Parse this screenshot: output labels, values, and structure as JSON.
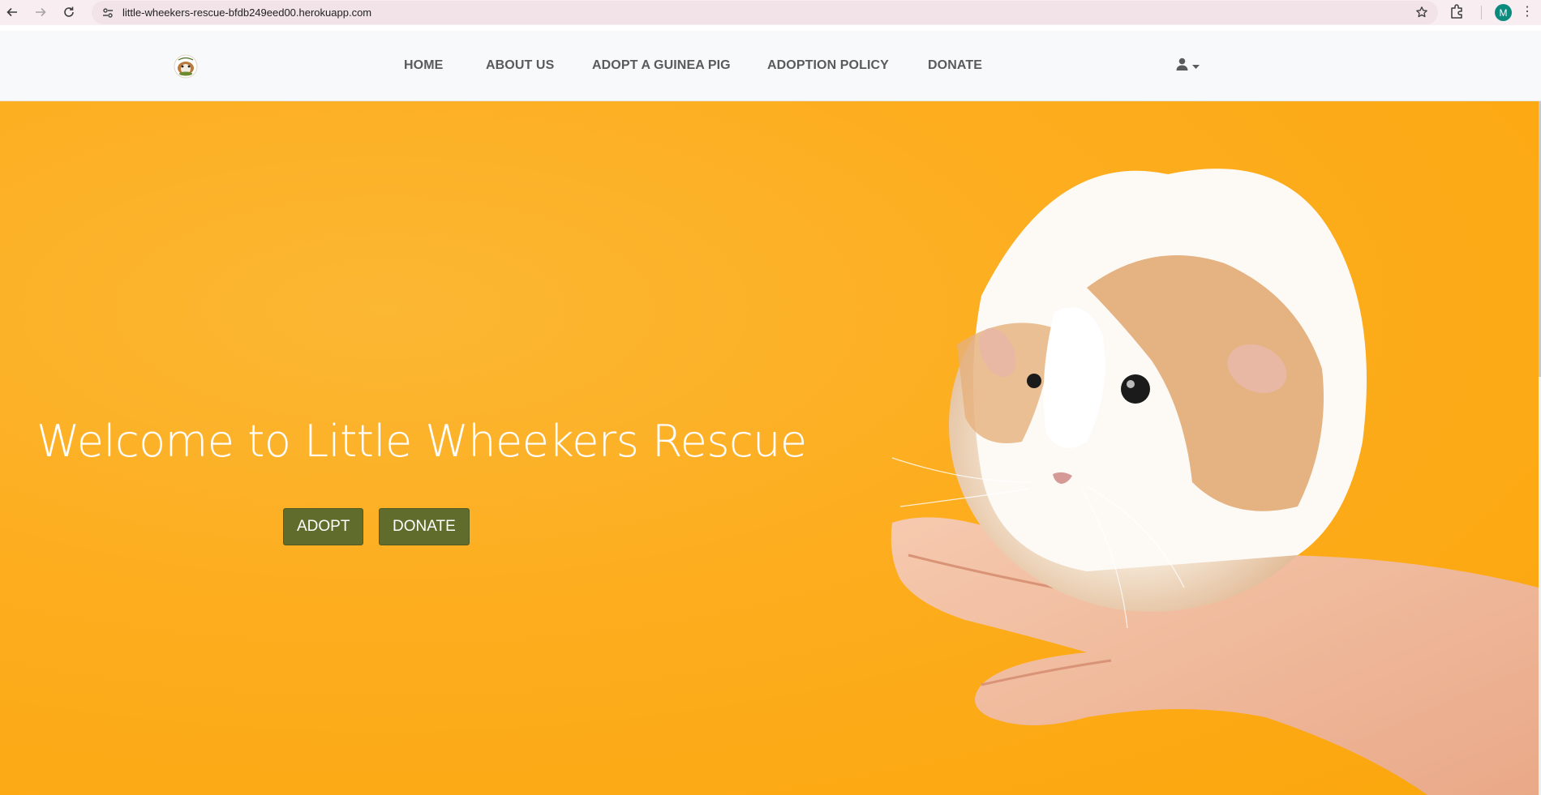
{
  "browser": {
    "url": "little-wheekers-rescue-bfdb249eed00.herokuapp.com",
    "profile_initial": "M",
    "icons": [
      "back-icon",
      "forward-icon",
      "reload-icon",
      "site-info-icon",
      "bookmark-star-icon",
      "extensions-icon",
      "more-menu-icon"
    ]
  },
  "navbar": {
    "logo_alt": "Little Wheekers Rescue logo",
    "links": [
      {
        "label": "HOME"
      },
      {
        "label": "ABOUT US"
      },
      {
        "label": "ADOPT A GUINEA PIG"
      },
      {
        "label": "ADOPTION POLICY"
      },
      {
        "label": "DONATE"
      }
    ],
    "account_icon": "user-icon"
  },
  "hero": {
    "title": "Welcome to Little Wheekers Rescue",
    "buttons": [
      {
        "label": "ADOPT"
      },
      {
        "label": "DONATE"
      }
    ],
    "image_subject": "guinea pig sitting on a hand",
    "colors": {
      "background": "#fdad1e",
      "button": "#606c2b",
      "title": "#ffffff"
    }
  }
}
